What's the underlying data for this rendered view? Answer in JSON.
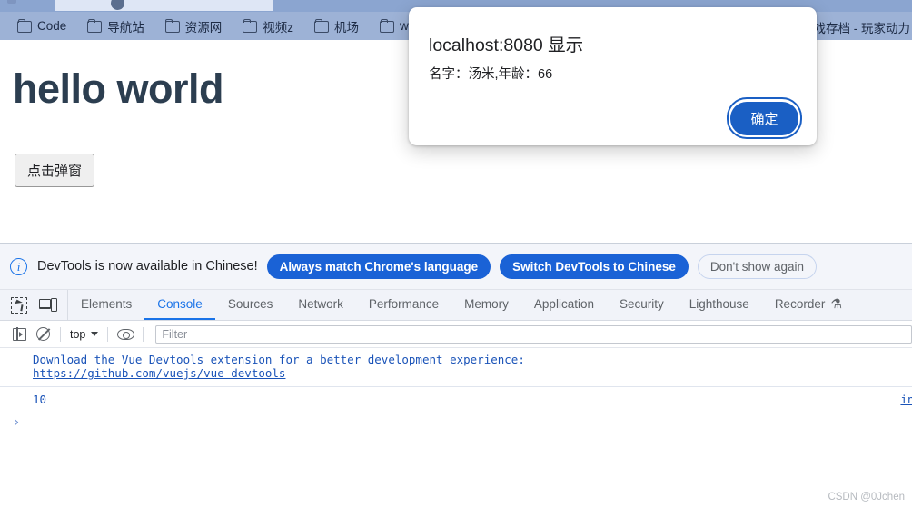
{
  "browser": {
    "bookmarks": [
      {
        "label": "Code",
        "icon": "folder-icon"
      },
      {
        "label": "导航站",
        "icon": "folder-icon"
      },
      {
        "label": "资源网",
        "icon": "folder-icon"
      },
      {
        "label": "视频z",
        "icon": "folder-icon"
      },
      {
        "label": "机场",
        "icon": "folder-icon"
      },
      {
        "label": "wallp",
        "icon": "folder-icon"
      }
    ],
    "bookmark_overflow_label": "游戏存档 - 玩家动力"
  },
  "page": {
    "heading": "hello world",
    "button_label": "点击弹窗"
  },
  "dialog": {
    "origin_title": "localhost:8080 显示",
    "message": "名字：汤米,年龄：66",
    "ok_label": "确定"
  },
  "devtools": {
    "notice": {
      "icon": "info-icon",
      "text": "DevTools is now available in Chinese!",
      "primary_button_1": "Always match Chrome's language",
      "primary_button_2": "Switch DevTools to Chinese",
      "ghost_button": "Don't show again"
    },
    "tool_icons": [
      {
        "name": "inspect-element-icon"
      },
      {
        "name": "device-toolbar-icon"
      }
    ],
    "tabs": [
      {
        "label": "Elements",
        "active": false
      },
      {
        "label": "Console",
        "active": true
      },
      {
        "label": "Sources",
        "active": false
      },
      {
        "label": "Network",
        "active": false
      },
      {
        "label": "Performance",
        "active": false
      },
      {
        "label": "Memory",
        "active": false
      },
      {
        "label": "Application",
        "active": false
      },
      {
        "label": "Security",
        "active": false
      },
      {
        "label": "Lighthouse",
        "active": false
      },
      {
        "label": "Recorder",
        "active": false,
        "badge": "⚗"
      }
    ],
    "console_toolbar": {
      "sidebar_icon": "console-sidebar-icon",
      "clear_icon": "clear-console-icon",
      "context": "top",
      "eye_icon": "live-expression-eye-icon",
      "filter_placeholder": "Filter",
      "filter_value": ""
    },
    "console": {
      "messages": [
        {
          "line1": "Download the Vue Devtools extension for a better development experience:",
          "link": "https://github.com/vuejs/vue-devtools",
          "source": ""
        },
        {
          "value": "10",
          "source": "ind"
        }
      ],
      "prompt_caret": "›"
    }
  },
  "watermark": "CSDN @0Jchen"
}
